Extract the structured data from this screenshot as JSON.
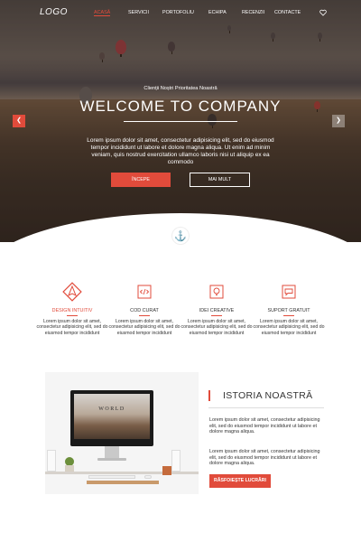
{
  "nav": {
    "logo": "LOGO",
    "items": [
      "ACASĂ",
      "SERVICII",
      "PORTOFOLIU",
      "ECHIPA",
      "RECENZII",
      "CONTACTE"
    ]
  },
  "hero": {
    "subtitle": "Clienții Noștri Prioritatea Noastră",
    "title": "WELCOME TO COMPANY",
    "text": "Lorem ipsum dolor sit amet, consectetur adipisicing elit, sed do eiusmod tempor incididunt ut labore et dolore magna aliqua. Ut enim ad minim veniam, quis nostrud exercitation ullamco laboris nisi ut aliquip ex ea commodo",
    "primary_button": "ÎNCEPE",
    "secondary_button": "MAI MULT"
  },
  "features": [
    {
      "title": "DESIGN INTUITIV",
      "text": "Lorem ipsum dolor sit amet, consectetur adipisicing elit, sed do eiusmod tempor incididunt",
      "icon": "diamond-icon"
    },
    {
      "title": "COD CURAT",
      "text": "Lorem ipsum dolor sit amet, consectetur adipisicing elit, sed do eiusmod tempor incididunt",
      "icon": "code-icon"
    },
    {
      "title": "IDEI CREATIVE",
      "text": "Lorem ipsum dolor sit amet, consectetur adipisicing elit, sed do eiusmod tempor incididunt",
      "icon": "lightbulb-icon"
    },
    {
      "title": "SUPORT GRATUIT",
      "text": "Lorem ipsum dolor sit amet, consectetur adipisicing elit, sed do eiusmod tempor incididunt",
      "icon": "chat-icon"
    }
  ],
  "story": {
    "title": "ISTORIA NOASTRĂ",
    "p1": "Lorem ipsum dolor sit amet, consectetur adipisicing elit, sed do eiusmod tempor incididunt ut labore et dolore magna aliqua.",
    "p2": "Lorem ipsum dolor sit amet, consectetur adipisicing elit, sed do eiusmod tempor incididunt ut labore et dolore magna aliqua.",
    "button": "RĂSFOIEȘTE LUCRĂRI",
    "screen_text": "WORLD"
  },
  "colors": {
    "accent": "#e14b3b",
    "text": "#333333",
    "white": "#ffffff"
  }
}
